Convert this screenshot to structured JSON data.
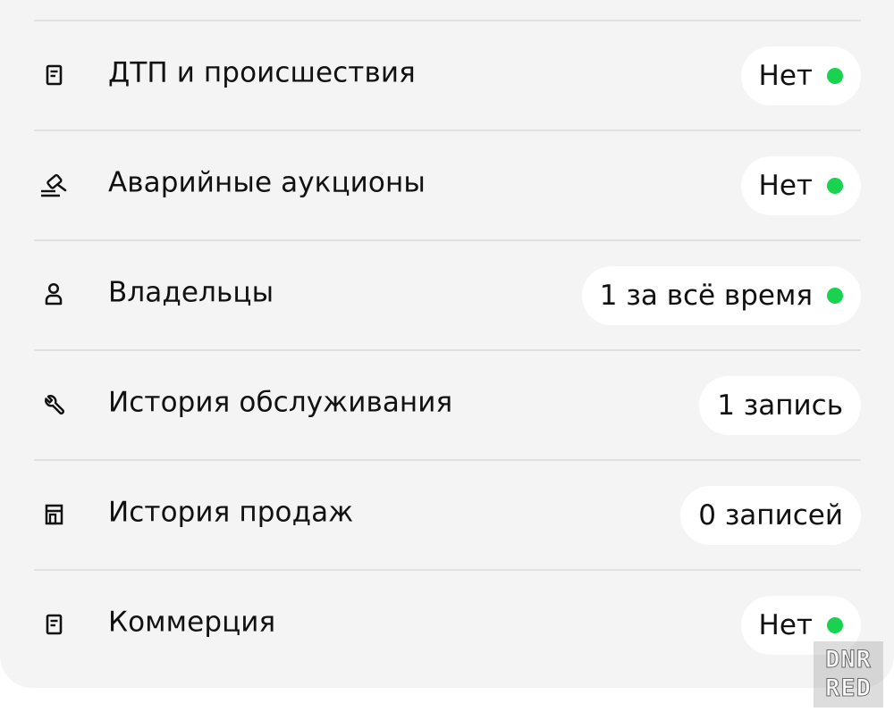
{
  "report": {
    "rows": [
      {
        "icon": "document-icon",
        "label": "ДТП и происшествия",
        "value": "Нет",
        "status_dot": true
      },
      {
        "icon": "auction-gavel-icon",
        "label": "Аварийные аукционы",
        "value": "Нет",
        "status_dot": true
      },
      {
        "icon": "person-icon",
        "label": "Владельцы",
        "value": "1 за всё время",
        "status_dot": true
      },
      {
        "icon": "wrench-icon",
        "label": "История обслуживания",
        "value": "1 запись",
        "status_dot": false
      },
      {
        "icon": "storefront-icon",
        "label": "История продаж",
        "value": "0 записей",
        "status_dot": false
      },
      {
        "icon": "document-icon",
        "label": "Коммерция",
        "value": "Нет",
        "status_dot": true
      }
    ]
  },
  "colors": {
    "card_background": "#f4f4f4",
    "pill_background": "#ffffff",
    "status_ok": "#19d24f",
    "divider": "#e1e1e1"
  },
  "watermark": {
    "line1": "DNR",
    "line2": "RED"
  }
}
